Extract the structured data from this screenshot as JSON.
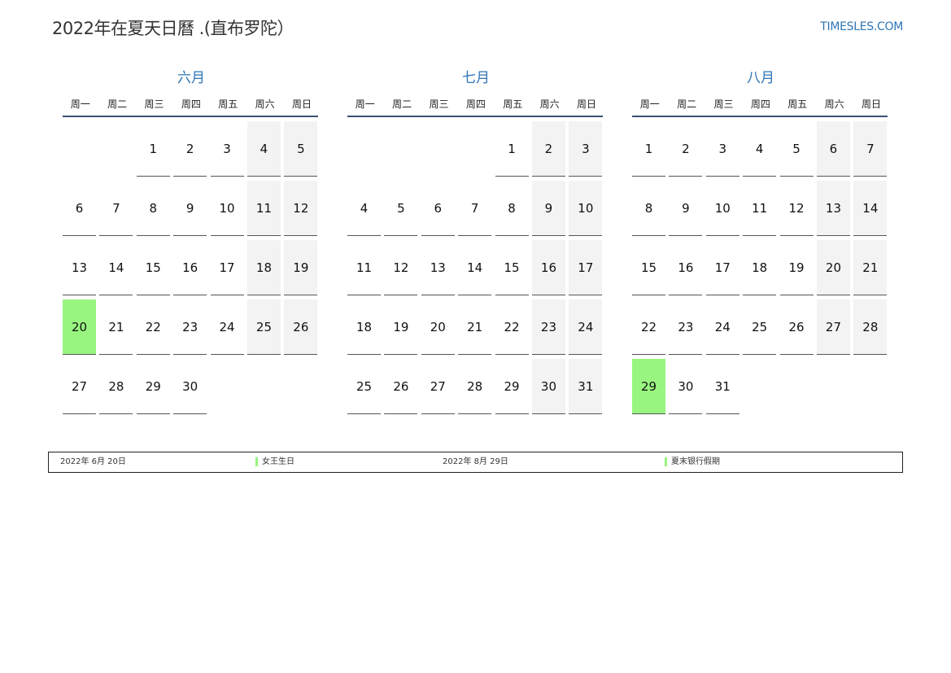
{
  "header": {
    "title": "2022年在夏天日曆 .(直布罗陀）",
    "site": "TIMESLES.COM"
  },
  "weekdays": [
    "周一",
    "周二",
    "周三",
    "周四",
    "周五",
    "周六",
    "周日"
  ],
  "months": [
    {
      "name": "六月",
      "offset": 2,
      "days": 30,
      "holidays": [
        20
      ]
    },
    {
      "name": "七月",
      "offset": 4,
      "days": 31,
      "holidays": []
    },
    {
      "name": "八月",
      "offset": 0,
      "days": 31,
      "holidays": [
        29
      ]
    }
  ],
  "legend": [
    {
      "date": "2022年 6月 20日",
      "name": "女王生日"
    },
    {
      "date": "2022年 8月 29日",
      "name": "夏末银行假期"
    }
  ],
  "colors": {
    "accent": "#2e75b6",
    "holiday": "#98f57f",
    "weekend": "#f3f3f3"
  }
}
